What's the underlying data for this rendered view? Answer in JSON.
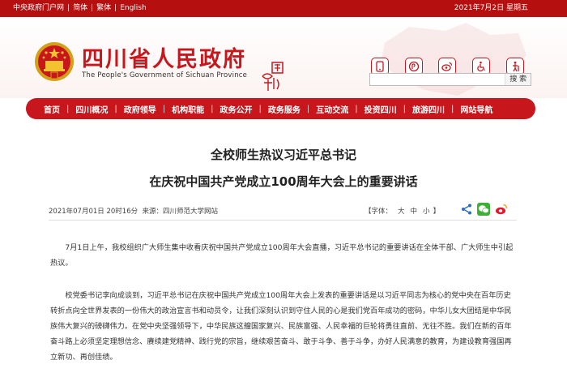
{
  "topbar": {
    "links": [
      "中央政府门户网",
      "简体",
      "繁体",
      "English"
    ],
    "date": "2021年7月2日 星期五"
  },
  "header": {
    "title": "四川省人民政府",
    "subtitle": "The People's Government of Sichuan Province",
    "seal_text": "中国四川",
    "icons": [
      "mobile-icon",
      "wechat-mini-program-icon",
      "weibo-icon",
      "accessibility-icon",
      "elder-mode-icon"
    ],
    "search": {
      "placeholder": "",
      "button_label": "搜 索"
    }
  },
  "nav": {
    "items": [
      "首页",
      "四川概况",
      "政府领导",
      "机构职能",
      "政务公开",
      "政务服务",
      "互动交流",
      "投资四川",
      "旅游四川",
      "网站导航"
    ]
  },
  "article": {
    "title_line1": "全校师生热议习近平总书记",
    "title_line2": "在庆祝中国共产党成立100周年大会上的重要讲话",
    "date": "2021年07月01日 20时16分",
    "source_label": "来源：四川师范大学网站",
    "font_size": {
      "label": "【字体：",
      "large": "大",
      "medium": "中",
      "small": "小",
      "close": "】"
    },
    "share_icons": [
      "share-icon",
      "wechat-icon",
      "weibo-icon"
    ],
    "paragraphs": [
      "7月1日上午，我校组织广大师生集中收看庆祝中国共产党成立100周年大会直播，习近平总书记的重要讲话在全体干部、广大师生中引起热议。",
      "校党委书记李向成谈到，习近平总书记在庆祝中国共产党成立100周年大会上发表的重要讲话是以习近平同志为核心的党中央在百年历史转折点向全世界发表的一份伟大的政治宣言书和动员令，让我们深刻认识到守住人民的心是我们党百年成功的密码，中华儿女大团结是中华民族伟大复兴的磅礴伟力。在党中央坚强领导下，中华民族这艘国家复兴、民族富强、人民幸福的巨轮将勇往直前、无往不胜。我们在新的百年奋斗路上必须坚定理想信念、赓续建党精神、践行党的宗旨，继续艰苦奋斗、敢于斗争、善于斗争，办好人民满意的教育，为建设教育强国再立新功、再创佳绩。"
    ]
  },
  "colors": {
    "brand_red": "#c8161d",
    "topbar_red": "#b50f0f"
  }
}
